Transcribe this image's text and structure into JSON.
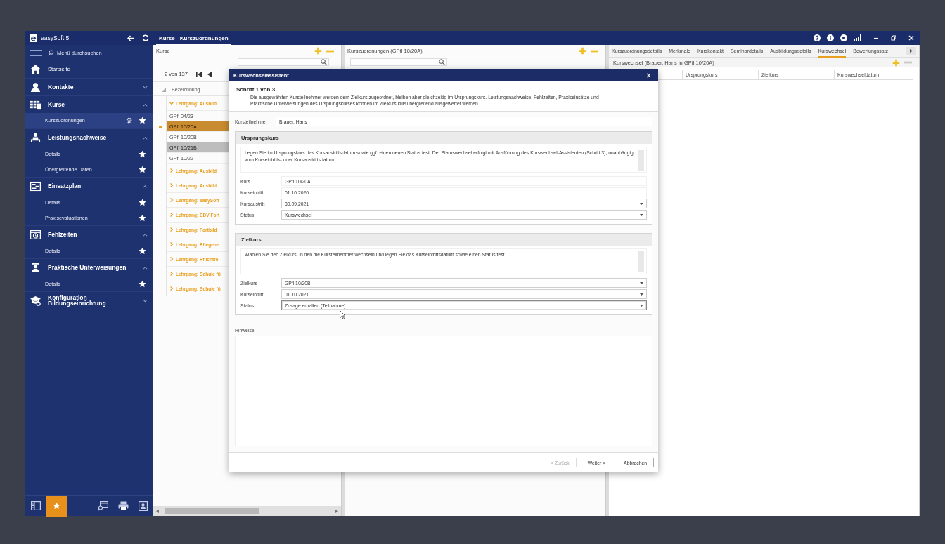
{
  "window": {
    "app_name": "easySoft 5",
    "tab": {
      "label": "Kurse - Kurszuordnungen",
      "selected": true
    }
  },
  "sidebar": {
    "search_placeholder": "Menü durchsuchen",
    "items": [
      {
        "kind": "link",
        "label": "Startseite"
      },
      {
        "kind": "section",
        "label": "Kontakte",
        "expanded": false
      },
      {
        "kind": "section",
        "label": "Kurse",
        "expanded": true,
        "children": [
          {
            "label": "Kurszuordnungen",
            "selected": true,
            "favorite": true,
            "settings": true
          }
        ]
      },
      {
        "kind": "section",
        "label": "Leistungsnachweise",
        "expanded": true,
        "children": [
          {
            "label": "Details",
            "selected": false,
            "favorite": true,
            "settings": false
          },
          {
            "label": "Übergreifende Daten",
            "selected": false,
            "favorite": true,
            "settings": false
          }
        ]
      },
      {
        "kind": "section",
        "label": "Einsatzplan",
        "expanded": true,
        "children": [
          {
            "label": "Details",
            "selected": false,
            "favorite": true,
            "settings": false
          },
          {
            "label": "Praxisevaluationen",
            "selected": false,
            "favorite": true,
            "settings": false
          }
        ]
      },
      {
        "kind": "section",
        "label": "Fehlzeiten",
        "expanded": true,
        "children": [
          {
            "label": "Details",
            "selected": false,
            "favorite": true,
            "settings": false
          }
        ]
      },
      {
        "kind": "section",
        "label": "Praktische Unterweisungen",
        "expanded": true,
        "children": [
          {
            "label": "Details",
            "selected": false,
            "favorite": true,
            "settings": false
          }
        ]
      },
      {
        "kind": "section",
        "label": "Konfiguration Bildungseinrichtung",
        "expanded": false
      }
    ],
    "favorites_selected": true
  },
  "courses_panel": {
    "title": "Kurse",
    "record_counter": "2 von 137",
    "column": "Bezeichnung",
    "groups": [
      {
        "label": "Lehrgang: Ausbild",
        "expanded": true,
        "children": [
          {
            "label": "GPfl 04/23",
            "selected": false,
            "highlighted": false
          },
          {
            "label": "GPfl 10/20A",
            "selected": true,
            "highlighted": false
          },
          {
            "label": "GPfl 10/20B",
            "selected": false,
            "highlighted": false
          },
          {
            "label": "GPfl 10/21B",
            "selected": false,
            "highlighted": true
          },
          {
            "label": "GPfl 10/22",
            "selected": false,
            "highlighted": false
          }
        ]
      },
      {
        "label": "Lehrgang: Ausbild",
        "expanded": false
      },
      {
        "label": "Lehrgang: Ausbild",
        "expanded": false
      },
      {
        "label": "Lehrgang: easySoft",
        "expanded": false
      },
      {
        "label": "Lehrgang: EDV Fort",
        "expanded": false
      },
      {
        "label": "Lehrgang: Fortbild",
        "expanded": false
      },
      {
        "label": "Lehrgang: Pflegehe",
        "expanded": false
      },
      {
        "label": "Lehrgang: Pflichtfo",
        "expanded": false
      },
      {
        "label": "Lehrgang: Schule fü",
        "expanded": false
      },
      {
        "label": "Lehrgang: Schule fü",
        "expanded": false
      }
    ]
  },
  "assignments_panel": {
    "title": "Kurszuordnungen (GPfl 10/20A)"
  },
  "details_panel": {
    "tabs": [
      {
        "label": "Kurszuordnungsdetails",
        "selected": false
      },
      {
        "label": "Merkmale",
        "selected": false
      },
      {
        "label": "Kurskontakt",
        "selected": false
      },
      {
        "label": "Seminardetails",
        "selected": false
      },
      {
        "label": "Ausbildungsdetails",
        "selected": false
      },
      {
        "label": "Kurswechsel",
        "selected": true
      },
      {
        "label": "Bewertungssatz",
        "selected": false
      }
    ],
    "title": "Kurswechsel (Brauer, Hans in GPfl 10/20A)",
    "columns": [
      "Ursprungskurs",
      "Zielkurs",
      "Kurswechseldatum"
    ]
  },
  "dialog": {
    "title": "Kurswechselassistent",
    "step": "Schritt 1 von 3",
    "description": "Die ausgewählten Kursteilnehmer werden dem Zielkurs zugeordnet, bleiben aber gleichzeitig im Ursprungskurs. Leistungsnachweise, Fehlzeiten, Praxiseinsätze und Praktische Unterweisungen des Ursprungskurses können im Zielkurs kursübergreifend ausgewertet werden.",
    "participant": {
      "label": "Kursteilnehmer",
      "value": "Brauer, Hans"
    },
    "groups": [
      {
        "title": "Ursprungskurs",
        "note": "Legen Sie im Ursprungskurs das Kursaustrittsdatum sowie ggf. einen neuen Status fest. Der Statuswechsel erfolgt mit Ausführung des Kurswechsel-Assistenten (Schritt 3), unabhängig vom Kurseintritts- oder Kursaustrittsdatum.",
        "fields": [
          {
            "kind": "readonly",
            "label": "Kurs",
            "value": "GPfl 10/20A",
            "focused": false
          },
          {
            "kind": "readonly",
            "label": "Kurseintritt",
            "value": "01.10.2020",
            "focused": false
          },
          {
            "kind": "dropdown",
            "label": "Kursaustritt",
            "value": "30.09.2021",
            "focused": false
          },
          {
            "kind": "dropdown",
            "label": "Status",
            "value": "Kurswechsel",
            "focused": false
          }
        ]
      },
      {
        "title": "Zielkurs",
        "note": "Wählen Sie den Zielkurs, in den die Kursteilnehmer wechseln und legen Sie das Kurseintrittsdatum sowie einen Status fest.",
        "fields": [
          {
            "kind": "dropdown",
            "label": "Zielkurs",
            "value": "GPfl 10/20B",
            "focused": false
          },
          {
            "kind": "dropdown",
            "label": "Kurseintritt",
            "value": "01.10.2021",
            "focused": false
          },
          {
            "kind": "dropdown",
            "label": "Status",
            "value": "Zusage erhalten (Teilnahme)",
            "focused": true
          }
        ]
      }
    ],
    "notes_label": "Hinweise",
    "buttons": [
      {
        "label": "< Zurück",
        "disabled": true
      },
      {
        "label": "Weiter >",
        "disabled": false
      },
      {
        "label": "Abbrechen",
        "disabled": false
      }
    ]
  }
}
